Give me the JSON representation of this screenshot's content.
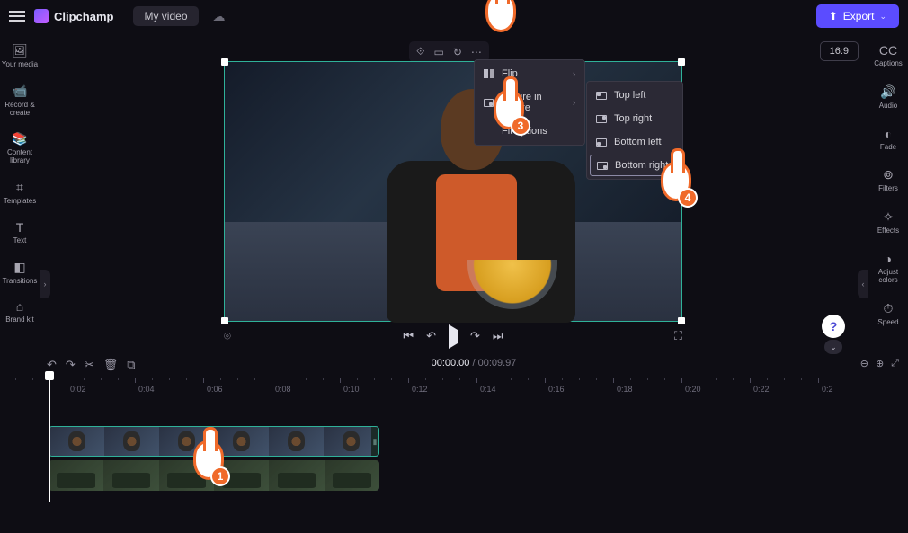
{
  "topbar": {
    "brand": "Clipchamp",
    "filename": "My video",
    "export_label": "Export"
  },
  "left_sidebar": {
    "items": [
      {
        "label": "Your media",
        "icon": "🖼"
      },
      {
        "label": "Record & create",
        "icon": "📹"
      },
      {
        "label": "Content library",
        "icon": "📚"
      },
      {
        "label": "Templates",
        "icon": "⌗"
      },
      {
        "label": "Text",
        "icon": "T"
      },
      {
        "label": "Transitions",
        "icon": "◧"
      },
      {
        "label": "Brand kit",
        "icon": "⌂"
      }
    ]
  },
  "right_sidebar": {
    "items": [
      {
        "label": "Captions",
        "icon": "CC"
      },
      {
        "label": "Audio",
        "icon": "🔊"
      },
      {
        "label": "Fade",
        "icon": "◐"
      },
      {
        "label": "Filters",
        "icon": "⊚"
      },
      {
        "label": "Effects",
        "icon": "✧"
      },
      {
        "label": "Adjust colors",
        "icon": "◑"
      },
      {
        "label": "Speed",
        "icon": "⏱"
      }
    ]
  },
  "ratio": "16:9",
  "context_menu": {
    "items": [
      {
        "label": "Flip"
      },
      {
        "label": "Picture in picture"
      },
      {
        "label": "Fit options"
      }
    ],
    "submenu": [
      {
        "label": "Top left"
      },
      {
        "label": "Top right"
      },
      {
        "label": "Bottom left"
      },
      {
        "label": "Bottom right"
      }
    ]
  },
  "timeline": {
    "current": "00:00.00",
    "separator": "/",
    "total": "00:09.97",
    "ticks": [
      "0:02",
      "0:04",
      "0:06",
      "0:08",
      "0:10",
      "0:12",
      "0:14",
      "0:16",
      "0:18",
      "0:20",
      "0:22",
      "0:2"
    ]
  },
  "callouts": {
    "one": "1",
    "three": "3",
    "four": "4"
  },
  "help": "?"
}
